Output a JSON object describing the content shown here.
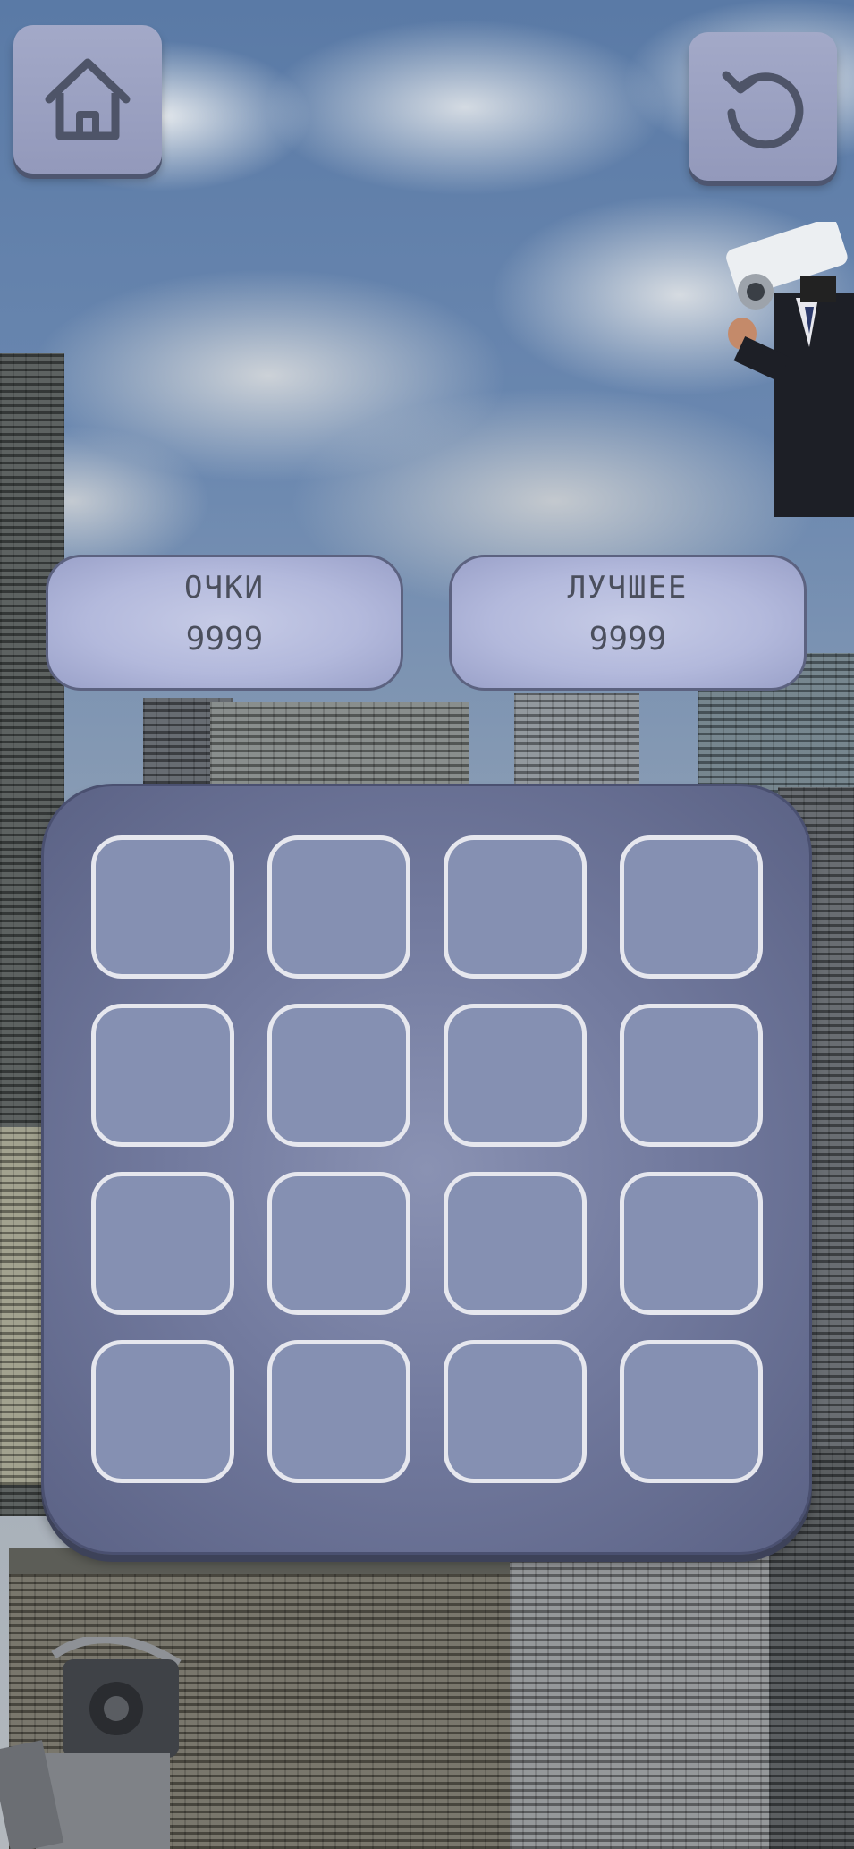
{
  "buttons": {
    "home_icon": "home-icon",
    "restart_icon": "restart-icon"
  },
  "scores": {
    "score_label": "ОЧКИ",
    "score_value": "9999",
    "best_label": "ЛУЧШЕЕ",
    "best_value": "9999"
  },
  "board": {
    "rows": 4,
    "columns": 4,
    "cells": [
      [
        "",
        "",
        "",
        ""
      ],
      [
        "",
        "",
        "",
        ""
      ],
      [
        "",
        "",
        "",
        ""
      ],
      [
        "",
        "",
        "",
        ""
      ]
    ]
  },
  "colors": {
    "button_fill": "#9aa0c2",
    "icon_stroke": "#4e5468",
    "board_fill": "#737b9f",
    "cell_fill": "#8590b2",
    "cell_border": "#e6e7ee",
    "score_text": "#4b4f5d"
  }
}
